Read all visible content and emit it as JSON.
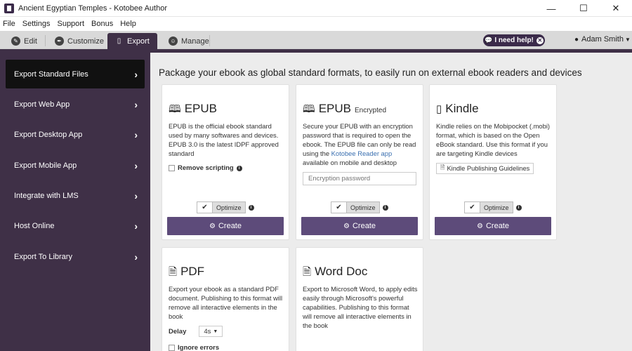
{
  "window": {
    "title": "Ancient Egyptian Temples - Kotobee Author",
    "minimize": "—",
    "maximize": "☐",
    "close": "✕"
  },
  "menu": [
    "File",
    "Settings",
    "Support",
    "Bonus",
    "Help"
  ],
  "tabs": [
    {
      "label": "Edit",
      "icon": "pencil-icon",
      "glyph": "✎"
    },
    {
      "label": "Customize",
      "icon": "brush-icon",
      "glyph": "✒"
    },
    {
      "label": "Export",
      "icon": "mobile-icon",
      "glyph": "▯"
    },
    {
      "label": "Manage",
      "icon": "person-icon",
      "glyph": "☺"
    }
  ],
  "help_button": {
    "label": "I need help!",
    "icon": "chat-icon",
    "close_icon": "close-icon"
  },
  "user": {
    "name": "Adam Smith",
    "icon": "user-icon"
  },
  "sidebar": {
    "items": [
      {
        "label": "Export Standard Files",
        "active": true
      },
      {
        "label": "Export Web App"
      },
      {
        "label": "Export Desktop App"
      },
      {
        "label": "Export Mobile App"
      },
      {
        "label": "Integrate with LMS"
      },
      {
        "label": "Host Online"
      },
      {
        "label": "Export To Library"
      }
    ],
    "chevron": "›"
  },
  "main": {
    "headline": "Package your ebook as global standard formats, to easily run on external ebook readers and devices",
    "cards": {
      "epub": {
        "title": "EPUB",
        "icon": "book-icon",
        "desc": "EPUB is the official ebook standard used by many softwares and devices. EPUB 3.0 is the latest IDPF approved standard",
        "checkbox": "Remove scripting",
        "optimize": "Optimize",
        "create": "Create"
      },
      "epub_enc": {
        "title": "EPUB",
        "subtitle": "Encrypted",
        "icon": "book-icon",
        "desc_before": "Secure your EPUB with an encryption password that is required to open the ebook. The EPUB file can only be read using the ",
        "desc_link": "Kotobee Reader app",
        "desc_after": " available on mobile and desktop",
        "input_placeholder": "Encryption password",
        "optimize": "Optimize",
        "create": "Create"
      },
      "kindle": {
        "title": "Kindle",
        "icon": "tablet-icon",
        "desc": "Kindle relies on the Mobipocket (.mobi) format, which is based on the Open eBook standard. Use this format if you are targeting Kindle devices",
        "guide_button": "Kindle Publishing Guidelines",
        "optimize": "Optimize",
        "create": "Create"
      },
      "pdf": {
        "title": "PDF",
        "icon": "pdf-file-icon",
        "desc": "Export your ebook as a standard PDF document. Publishing to this format will remove all interactive elements in the book",
        "delay_label": "Delay",
        "delay_value": "4s",
        "checkbox": "Ignore errors"
      },
      "word": {
        "title": "Word Doc",
        "icon": "word-file-icon",
        "desc": "Export to Microsoft Word, to apply edits easily through Microsoft's powerful capabilities. Publishing to this format will remove all interactive elements in the book"
      }
    }
  },
  "colors": {
    "sidebar": "#3f3047",
    "sidebar_active": "#111111",
    "create_button": "#5d4b7a",
    "content_bg": "#ececec",
    "link": "#3a6fb0"
  }
}
